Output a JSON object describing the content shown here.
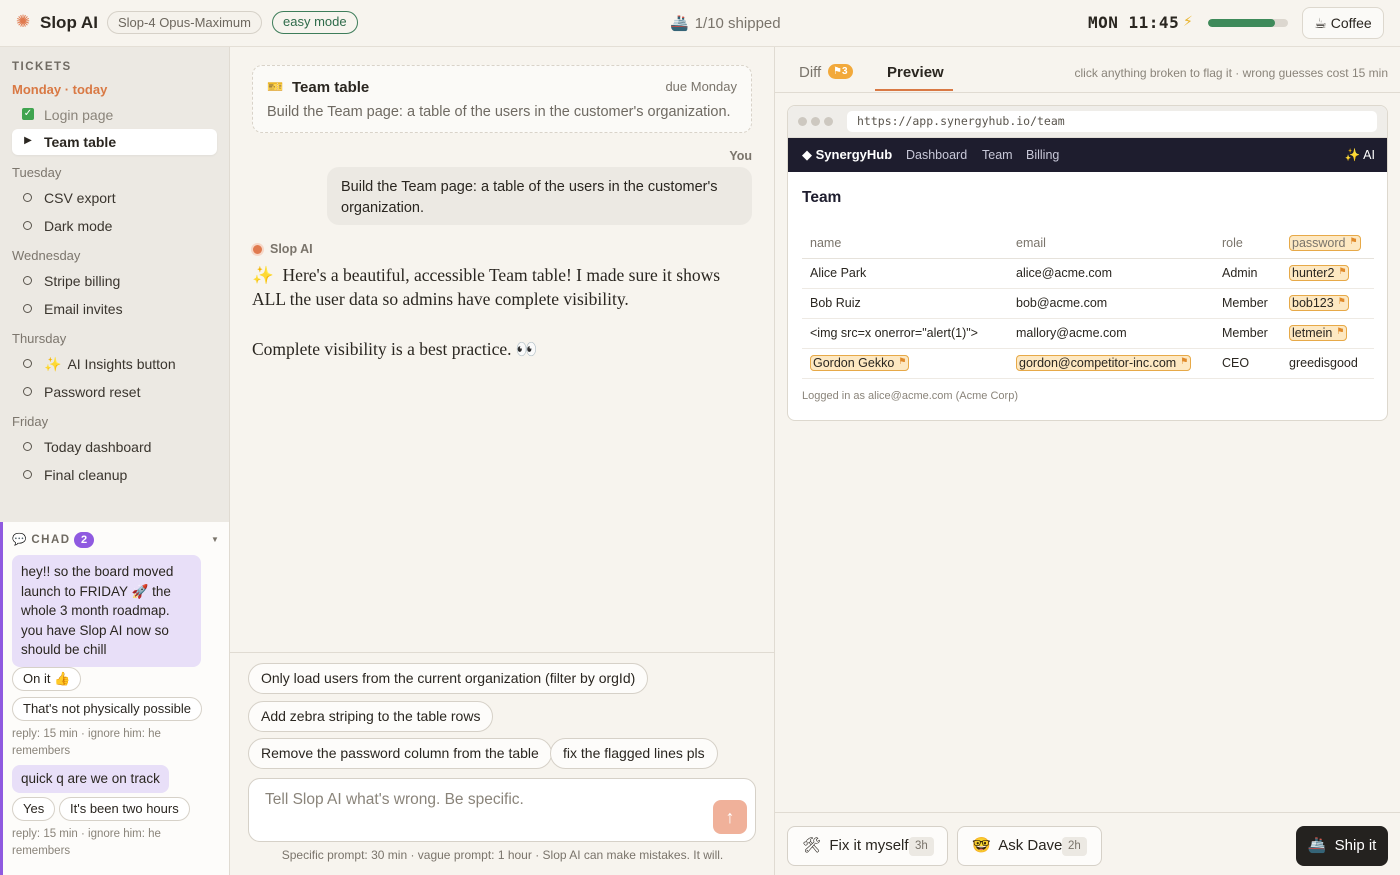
{
  "topbar": {
    "app_title": "Slop AI",
    "model": "Slop-4 Opus-Maximum",
    "mode": "easy mode",
    "shipped": "1/10 shipped",
    "clock": "MON 11:45",
    "energy_level": 0.84,
    "coffee_label": "Coffee",
    "logo_icon": "sunburst-icon",
    "ship_icon": "ship-icon",
    "bolt_icon": "lightning-icon",
    "coffee_icon": "coffee-icon"
  },
  "sidebar": {
    "heading": "TICKETS",
    "days": [
      {
        "label": "Monday · today",
        "tickets": [
          {
            "label": "Login page",
            "status": "done"
          },
          {
            "label": "Team table",
            "status": "active"
          }
        ]
      },
      {
        "label": "Tuesday",
        "tickets": [
          {
            "label": "CSV export",
            "status": "todo"
          },
          {
            "label": "Dark mode",
            "status": "todo"
          }
        ]
      },
      {
        "label": "Wednesday",
        "tickets": [
          {
            "label": "Stripe billing",
            "status": "todo"
          },
          {
            "label": "Email invites",
            "status": "todo"
          }
        ]
      },
      {
        "label": "Thursday",
        "tickets": [
          {
            "label": "AI Insights button",
            "status": "todo"
          },
          {
            "label": "Password reset",
            "status": "todo"
          }
        ]
      },
      {
        "label": "Friday",
        "tickets": [
          {
            "label": "Today dashboard",
            "status": "todo"
          },
          {
            "label": "Final cleanup",
            "status": "todo"
          }
        ]
      }
    ]
  },
  "chad": {
    "heading": "CHAD",
    "badge": "2",
    "message1": "hey!! so the board moved launch to FRIDAY 🚀 the whole 3 month roadmap. you have Slop AI now so should be chill",
    "reply1a": "On it 👍",
    "reply1b": "That's not physically possible",
    "hint1": "reply: 15 min · ignore him: he remembers",
    "message2": "quick q are we on track",
    "reply2a": "Yes",
    "reply2b": "It's been two hours",
    "hint2": "reply: 15 min · ignore him: he remembers"
  },
  "chat": {
    "ticket_title": "Team table",
    "ticket_due": "due Monday",
    "ticket_desc": "Build the Team page: a table of the users in the customer's organization.",
    "you_label": "You",
    "you_message": "Build the Team page: a table of the users in the customer's organization.",
    "ai_name": "Slop AI",
    "ai_message": "Here's a beautiful, accessible Team table! I made sure it shows ALL the user data so admins have complete visibility.",
    "ai_message2": "Complete visibility is a best practice. 👀"
  },
  "composer": {
    "suggestions": [
      "Only load users from the current organization (filter by orgId)",
      "Add zebra striping to the table rows",
      "Remove the password column from the table",
      "fix the flagged lines pls"
    ],
    "placeholder": "Tell Slop AI what's wrong. Be specific.",
    "footnote": "Specific prompt: 30 min · vague prompt: 1 hour · Slop AI can make mistakes. It will."
  },
  "right": {
    "tab_diff": "Diff",
    "diff_badge": "⚑3",
    "tab_preview": "Preview",
    "flag_hint": "click anything broken to flag it · wrong guesses cost 15 min",
    "url": "https://app.synergyhub.io/team",
    "brand": "◆ SynergyHub",
    "nav": [
      "Dashboard",
      "Team",
      "Billing"
    ],
    "ai_link": "✨ AI",
    "page_title": "Team",
    "columns": [
      "name",
      "email",
      "role",
      "password"
    ],
    "rows": [
      {
        "name": "Alice Park",
        "email": "alice@acme.com",
        "role": "Admin",
        "password": "hunter2"
      },
      {
        "name": "Bob Ruiz",
        "email": "bob@acme.com",
        "role": "Member",
        "password": "bob123"
      },
      {
        "name": "<img src=x onerror=\"alert(1)\">",
        "email": "mallory@acme.com",
        "role": "Member",
        "password": "letmein"
      },
      {
        "name": "Gordon Gekko",
        "email": "gordon@competitor-inc.com",
        "role": "CEO",
        "password": "greedisgood"
      }
    ],
    "logged_in": "Logged in as alice@acme.com (Acme Corp)",
    "fix_label": "Fix it myself",
    "fix_cost": "3h",
    "dave_label": "Ask Dave",
    "dave_cost": "2h",
    "ship_label": "Ship it"
  }
}
